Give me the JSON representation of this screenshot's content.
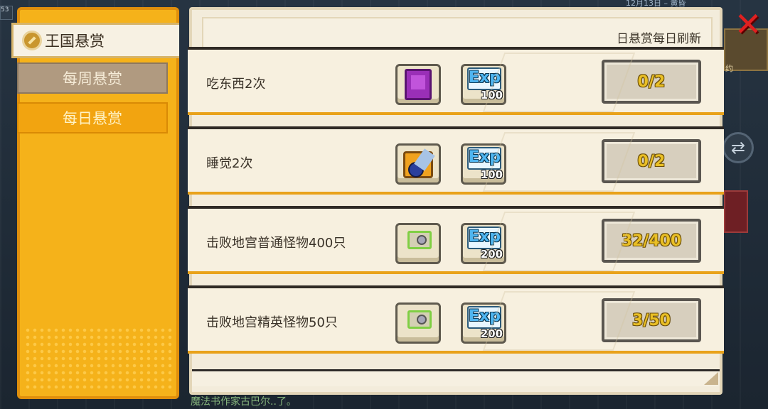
{
  "status": {
    "date": "12月13日 – 黄昏",
    "left_num": "53"
  },
  "tabs": [
    {
      "label": "王国悬赏",
      "state": "active"
    },
    {
      "label": "每周悬赏",
      "state": "inactive"
    },
    {
      "label": "每日悬赏",
      "state": "selected"
    }
  ],
  "header": {
    "note": "日悬赏每日刷新"
  },
  "quests": [
    {
      "name": "吃东西2次",
      "reward_icon": "purple-book-icon",
      "exp_label": "Exp",
      "exp": "100",
      "progress": "0/2"
    },
    {
      "name": "睡觉2次",
      "reward_icon": "scroll-icon",
      "exp_label": "Exp",
      "exp": "100",
      "progress": "0/2"
    },
    {
      "name": "击败地宫普通怪物400只",
      "reward_icon": "gem-icon",
      "exp_label": "Exp",
      "exp": "200",
      "progress": "32/400"
    },
    {
      "name": "击败地宫精英怪物50只",
      "reward_icon": "gem-icon",
      "exp_label": "Exp",
      "exp": "200",
      "progress": "3/50"
    }
  ],
  "side": {
    "right_label": "约"
  },
  "marquee": "魔法书作家古巴尔..了。",
  "close_icon": "close-x-icon",
  "colors": {
    "tab_panel": "#f5b21a",
    "progress_text": "#e9bf25",
    "close": "#e02020"
  }
}
